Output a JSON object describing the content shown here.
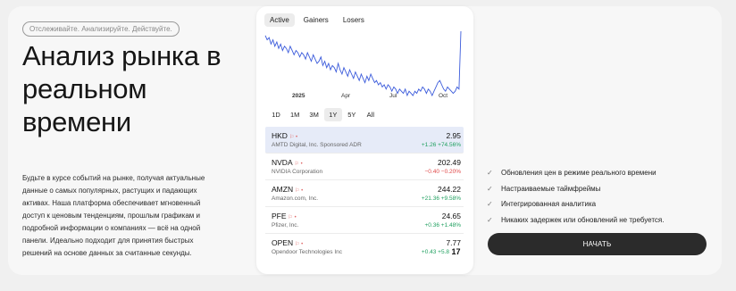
{
  "hero": {
    "tagline": "Отслеживайте. Анализируйте. Действуйте.",
    "headline_lines": [
      "Анализ рынка в",
      "реальном",
      "времени"
    ],
    "description_lines": [
      "Будьте в курсе событий на рынке, получая актуальные",
      "данные о самых популярных, растущих и падающих",
      "активах. Наша платформа обеспечивает мгновенный",
      "доступ к ценовым тенденциям, прошлым графикам и",
      "подробной информации о компаниях — всё на одной",
      "панели. Идеально подходит для принятия быстрых",
      "решений на основе данных за считанные секунды."
    ]
  },
  "widget": {
    "tabs": [
      "Active",
      "Gainers",
      "Losers"
    ],
    "active_tab": "Active",
    "ranges": [
      "1D",
      "1M",
      "3M",
      "1Y",
      "5Y",
      "All"
    ],
    "active_range": "1Y",
    "chart_data": {
      "type": "line",
      "x_labels": [
        "2025",
        "Apr",
        "Jul",
        "Oct"
      ],
      "series": [
        {
          "values": [
            4.1,
            3.9,
            4.0,
            3.7,
            3.9,
            3.6,
            3.8,
            3.5,
            3.7,
            3.4,
            3.6,
            3.5,
            3.3,
            3.6,
            3.4,
            3.2,
            3.4,
            3.3,
            3.1,
            3.3,
            3.2,
            3.0,
            3.3,
            3.1,
            2.9,
            3.2,
            3.0,
            2.8,
            2.9,
            3.1,
            2.7,
            2.9,
            2.6,
            2.8,
            2.5,
            2.7,
            2.6,
            2.4,
            2.8,
            2.5,
            2.3,
            2.6,
            2.4,
            2.2,
            2.5,
            2.3,
            2.1,
            2.4,
            2.2,
            2.0,
            2.3,
            2.1,
            1.9,
            2.2,
            2.0,
            2.3,
            2.1,
            1.9,
            2.0,
            1.8,
            1.9,
            1.7,
            1.8,
            1.6,
            1.8,
            1.7,
            1.5,
            1.7,
            1.6,
            1.4,
            1.6,
            1.5,
            1.4,
            1.6,
            1.3,
            1.5,
            1.4,
            1.3,
            1.5,
            1.4,
            1.6,
            1.5,
            1.7,
            1.6,
            1.4,
            1.6,
            1.5,
            1.3,
            1.5,
            1.7,
            1.9,
            2.0,
            1.8,
            1.6,
            1.5,
            1.7,
            1.6,
            1.5,
            1.4,
            1.5,
            1.7,
            1.6,
            4.3
          ],
          "color": "#3b5bdb"
        }
      ]
    },
    "stocks": [
      {
        "symbol": "HKD",
        "name": "AMTD Digital, Inc. Sponsored ADR",
        "price": "2.95",
        "change": "+1.26  +74.56%",
        "direction": "up",
        "selected": true
      },
      {
        "symbol": "NVDA",
        "name": "NVIDIA Corporation",
        "price": "202.49",
        "change": "−0.40  −0.20%",
        "direction": "down",
        "selected": false
      },
      {
        "symbol": "AMZN",
        "name": "Amazon.com, Inc.",
        "price": "244.22",
        "change": "+21.36  +9.58%",
        "direction": "up",
        "selected": false
      },
      {
        "symbol": "PFE",
        "name": "Pfizer, Inc.",
        "price": "24.65",
        "change": "+0.36  +1.48%",
        "direction": "up",
        "selected": false
      },
      {
        "symbol": "OPEN",
        "name": "Opendoor Technologies Inc",
        "price": "7.77",
        "change": "+0.43  +5.8",
        "direction": "up",
        "selected": false
      }
    ],
    "logo_text": "17"
  },
  "features": [
    "Обновления цен в режиме реального времени",
    "Настраиваемые таймфреймы",
    "Интегрированная аналитика",
    "Никаких задержек или обновлений не требуется."
  ],
  "cta": {
    "label": "НАЧАТЬ"
  },
  "icons": {
    "check": "check-icon",
    "marker": "flag-icon"
  },
  "colors": {
    "up": "#21a060",
    "down": "#e04848",
    "line": "#3b5bdb",
    "button": "#2b2b2b"
  }
}
